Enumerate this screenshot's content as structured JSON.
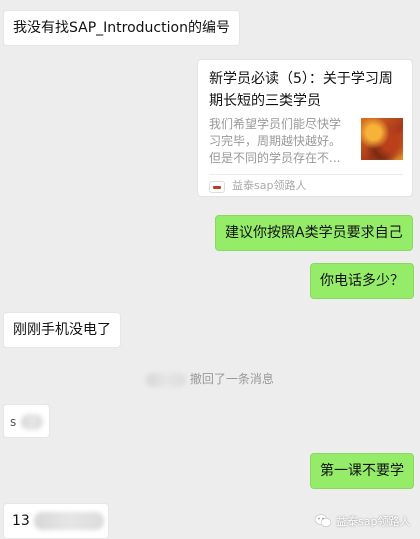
{
  "messages": {
    "m1": "我没有找SAP_Introduction的编号",
    "m3": "建议你按照A类学员要求自己",
    "m4": "你电话多少？",
    "m5": "刚刚手机没电了",
    "m7": "第一课不要学",
    "m8_prefix": "13",
    "m6_prefix": "s"
  },
  "card": {
    "title": "新学员必读（5）：关于学习周期长短的三类学员",
    "description": "我们希望学员们能尽快学习完毕，周期越快越好。但是不同的学员存在不...",
    "source": "益泰sap领路人"
  },
  "recall": {
    "text": "撤回了一条消息"
  },
  "watermark": {
    "text": "益泰sap领路人"
  },
  "colors": {
    "background": "#ededed",
    "sent_bubble": "#95ec69",
    "received_bubble": "#ffffff"
  }
}
